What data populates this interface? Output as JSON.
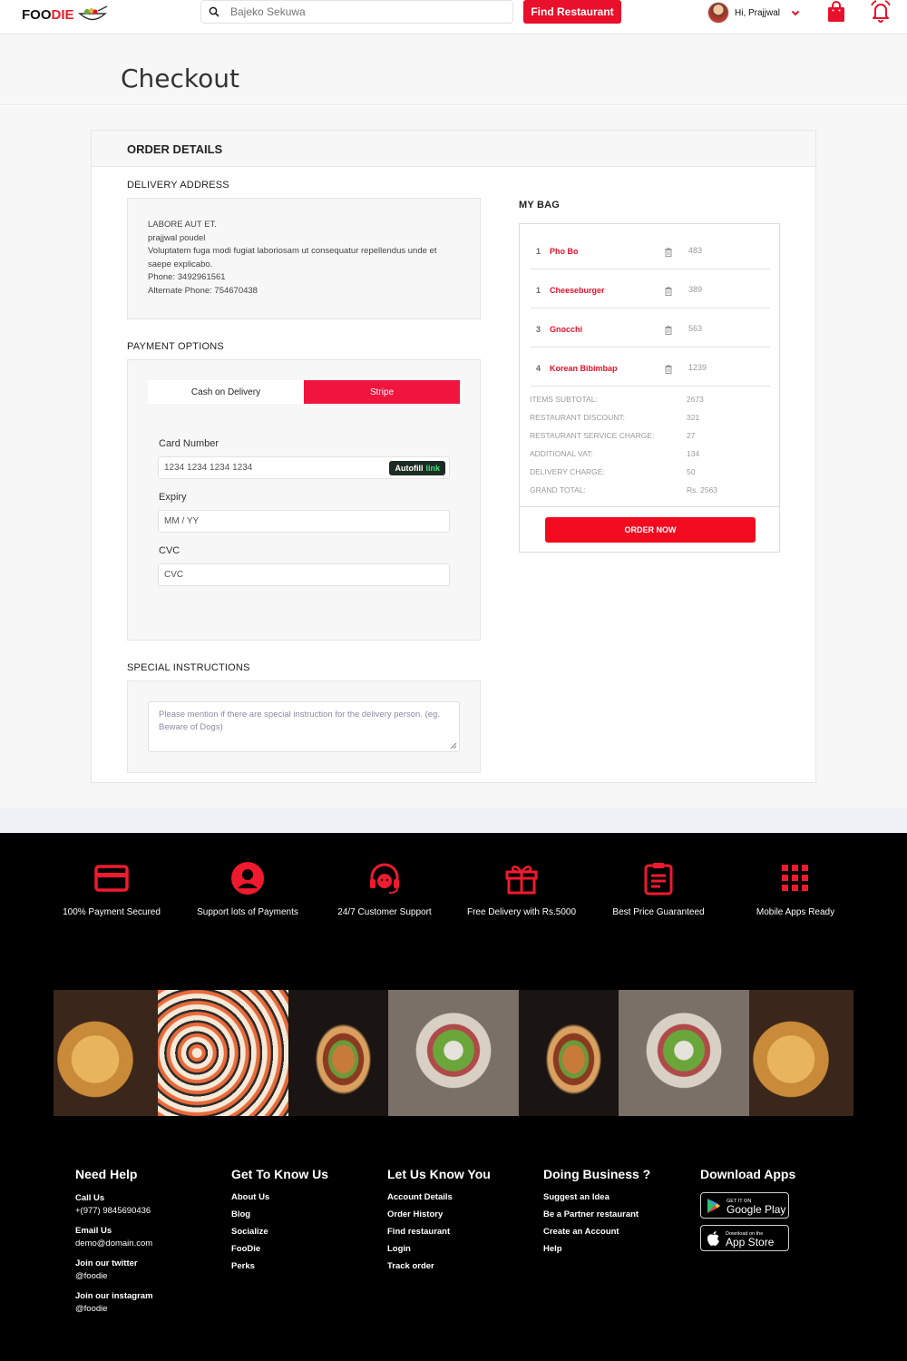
{
  "header": {
    "logo_text_dark": "FOO",
    "logo_text_red": "DIE",
    "search_placeholder": "Bajeko Sekuwa",
    "find_button": "Find Restaurant",
    "user_greeting": "Hi, Prajjwal"
  },
  "page_title": "Checkout",
  "order": {
    "heading": "ORDER DETAILS",
    "delivery_label": "DELIVERY ADDRESS",
    "address_lines": [
      "LABORE AUT ET.",
      "prajjwal poudel",
      "Voluptatem fuga modi fugiat laboriosam ut consequatur repellendus unde et saepe explicabo.",
      "Phone: 3492961561",
      "Alternate Phone: 754670438"
    ],
    "payment_label": "PAYMENT OPTIONS",
    "tabs": [
      "Cash on Delivery",
      "Stripe"
    ],
    "card_number_label": "Card Number",
    "card_number_placeholder": "1234 1234 1234 1234",
    "autofill_text": "Autofill",
    "autofill_link": "link",
    "expiry_label": "Expiry",
    "expiry_placeholder": "MM / YY",
    "cvc_label": "CVC",
    "cvc_placeholder": "CVC",
    "special_label": "SPECIAL INSTRUCTIONS",
    "special_placeholder": "Please mention if there are special instruction for the delivery person. (eg. Beware of Dogs)"
  },
  "bag": {
    "heading": "MY BAG",
    "items": [
      {
        "qty": "1",
        "name": "Pho Bo",
        "price": "483"
      },
      {
        "qty": "1",
        "name": "Cheeseburger",
        "price": "389"
      },
      {
        "qty": "3",
        "name": "Gnocchi",
        "price": "563"
      },
      {
        "qty": "4",
        "name": "Korean Bibimbap",
        "price": "1239"
      }
    ],
    "summary": [
      {
        "label": "ITEMS SUBTOTAL:",
        "value": "2673"
      },
      {
        "label": "RESTAURANT DISCOUNT:",
        "value": "321"
      },
      {
        "label": "RESTAURANT SERVICE CHARGE:",
        "value": "27"
      },
      {
        "label": "ADDITIONAL VAT:",
        "value": "134"
      },
      {
        "label": "DELIVERY CHARGE:",
        "value": "50"
      },
      {
        "label": "GRAND TOTAL:",
        "value": "Rs. 2563"
      }
    ],
    "order_button": "ORDER NOW"
  },
  "features": [
    {
      "label": "100% Payment Secured",
      "icon": "credit-card-icon"
    },
    {
      "label": "Support lots of Payments",
      "icon": "user-circle-icon"
    },
    {
      "label": "24/7 Customer Support",
      "icon": "headset-icon"
    },
    {
      "label": "Free Delivery with Rs.5000",
      "icon": "gift-icon"
    },
    {
      "label": "Best Price Guaranteed",
      "icon": "clipboard-icon"
    },
    {
      "label": "Mobile Apps Ready",
      "icon": "grid-icon"
    }
  ],
  "footer": {
    "help": {
      "title": "Need Help",
      "call_label": "Call Us",
      "call_value": "+(977) 9845690436",
      "email_label": "Email Us",
      "email_value": "demo@domain.com",
      "twitter_label": "Join our twitter",
      "twitter_value": "@foodie",
      "instagram_label": "Join our instagram",
      "instagram_value": "@foodie"
    },
    "know_us": {
      "title": "Get To Know Us",
      "links": [
        "About Us",
        "Blog",
        "Socialize",
        "FooDie",
        "Perks"
      ]
    },
    "know_you": {
      "title": "Let Us Know You",
      "links": [
        "Account Details",
        "Order History",
        "Find restaurant",
        "Login",
        "Track order"
      ]
    },
    "business": {
      "title": "Doing Business ?",
      "links": [
        "Suggest an Idea",
        "Be a Partner restaurant",
        "Create an Account",
        "Help"
      ]
    },
    "apps": {
      "title": "Download Apps",
      "google_small": "GET IT ON",
      "google_big": "Google Play",
      "apple_small": "Download on the",
      "apple_big": "App Store"
    }
  },
  "colors": {
    "accent": "#e8102a",
    "stripe_tab": "#f0153e",
    "footer_bg": "#000000"
  }
}
